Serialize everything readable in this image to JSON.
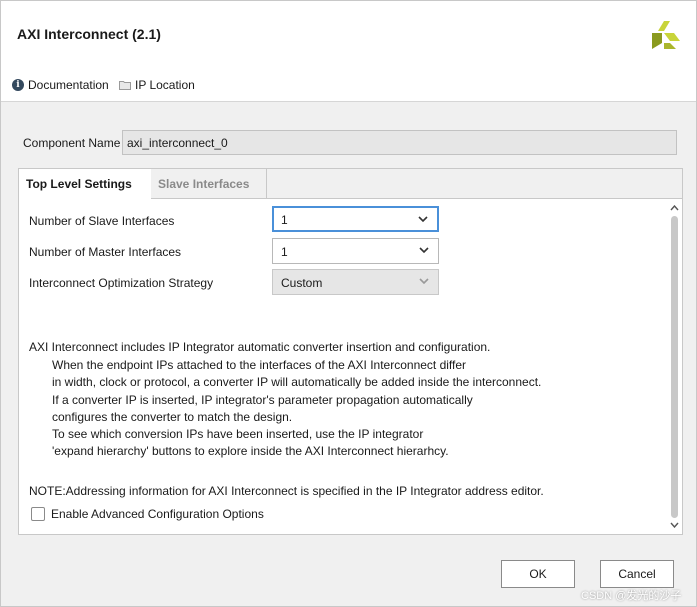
{
  "dialog": {
    "title": "AXI Interconnect (2.1)"
  },
  "links": {
    "documentation": "Documentation",
    "ip_location": "IP Location"
  },
  "component": {
    "label": "Component Name",
    "value": "axi_interconnect_0"
  },
  "tabs": [
    {
      "label": "Top Level Settings",
      "active": true
    },
    {
      "label": "Slave Interfaces",
      "active": false
    }
  ],
  "settings": [
    {
      "label": "Number of Slave Interfaces",
      "value": "1",
      "state": "focused"
    },
    {
      "label": "Number of Master Interfaces",
      "value": "1",
      "state": "normal"
    },
    {
      "label": "Interconnect Optimization Strategy",
      "value": "Custom",
      "state": "disabled"
    }
  ],
  "description": {
    "heading": "AXI Interconnect includes IP Integrator automatic converter insertion and configuration.",
    "lines": [
      "When the endpoint IPs attached to the interfaces of the AXI Interconnect differ",
      "in width, clock or protocol, a converter IP will automatically be added inside the interconnect.",
      "If a converter IP is inserted, IP integrator's parameter propagation automatically",
      "configures the converter to match the design.",
      "To see which conversion IPs have been inserted, use the IP integrator",
      "'expand hierarchy' buttons to explore inside the AXI Interconnect hierarhcy."
    ],
    "note": "NOTE:Addressing information for AXI Interconnect is specified in the IP Integrator address editor."
  },
  "advanced": {
    "label": "Enable Advanced Configuration Options",
    "checked": false
  },
  "buttons": {
    "ok": "OK",
    "cancel": "Cancel"
  },
  "watermark": "CSDN @发光的沙子",
  "colors": {
    "focus_border": "#4a90d9",
    "logo_light": "#c8d43a",
    "logo_dark": "#8a9a1e",
    "info_icon": "#34495e"
  }
}
